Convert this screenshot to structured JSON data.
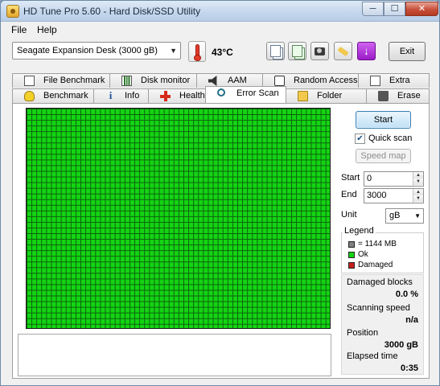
{
  "window": {
    "title": "HD Tune Pro 5.60 - Hard Disk/SSD Utility",
    "controls": {
      "minimize": "─",
      "maximize": "☐",
      "close": "✕"
    }
  },
  "menu": [
    {
      "label": "File"
    },
    {
      "label": "Help"
    }
  ],
  "toolbar": {
    "drive": "Seagate Expansion Desk (3000 gB)",
    "temperature": "43°C",
    "icons": [
      "copy-info-icon",
      "copy-results-icon",
      "screenshot-icon",
      "options-icon",
      "save-icon"
    ],
    "exit_label": "Exit"
  },
  "tabs": {
    "top_row": [
      {
        "label": "File Benchmark",
        "icon": "file-benchmark-icon"
      },
      {
        "label": "Disk monitor",
        "icon": "disk-monitor-icon"
      },
      {
        "label": "AAM",
        "icon": "speaker-icon"
      },
      {
        "label": "Random Access",
        "icon": "dice-icon"
      },
      {
        "label": "Extra tests",
        "icon": "extra-tests-icon"
      }
    ],
    "bottom_row": [
      {
        "label": "Benchmark",
        "icon": "bulb-icon"
      },
      {
        "label": "Info",
        "icon": "info-icon"
      },
      {
        "label": "Health",
        "icon": "health-cross-icon"
      },
      {
        "label": "Error Scan",
        "icon": "magnifier-icon",
        "active": true
      },
      {
        "label": "Folder Usage",
        "icon": "folder-icon"
      },
      {
        "label": "Erase",
        "icon": "trash-icon"
      }
    ]
  },
  "error_scan": {
    "block_colors": {
      "ok": "#14d414",
      "block_grid": "#0c5e0c"
    },
    "start_label": "Start",
    "quick_scan_label": "Quick scan",
    "quick_scan_checked": true,
    "speed_map_label": "Speed map",
    "start_field": {
      "label": "Start",
      "value": "0"
    },
    "end_field": {
      "label": "End",
      "value": "3000"
    },
    "unit": {
      "label": "Unit",
      "value": "gB"
    },
    "legend": {
      "title": "Legend",
      "items": [
        {
          "label": "= 1144 MB",
          "color": "#808080"
        },
        {
          "label": "Ok",
          "color": "#14d414"
        },
        {
          "label": "Damaged",
          "color": "#c81e1e"
        }
      ]
    },
    "stats": {
      "damaged_blocks": {
        "label": "Damaged blocks",
        "value": "0.0 %"
      },
      "scanning_speed": {
        "label": "Scanning speed",
        "value": "n/a"
      },
      "position": {
        "label": "Position",
        "value": "3000 gB"
      },
      "elapsed_time": {
        "label": "Elapsed time",
        "value": "0:35"
      }
    }
  }
}
